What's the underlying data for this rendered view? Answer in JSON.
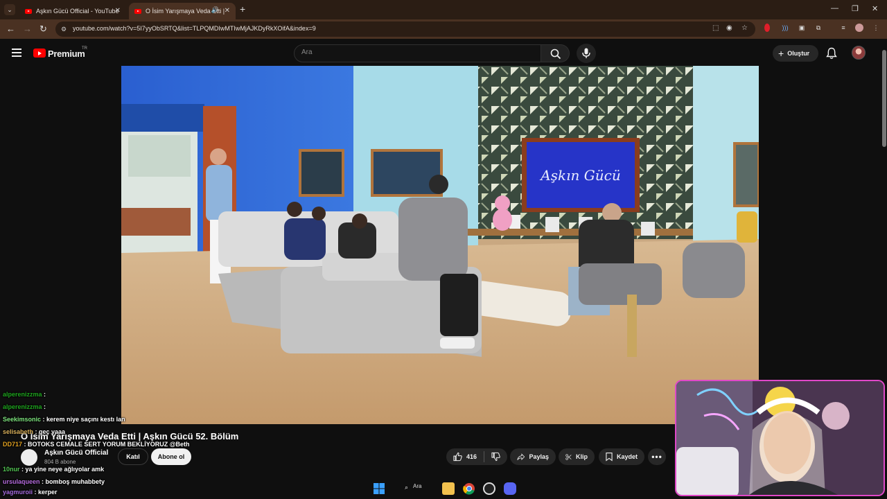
{
  "browser": {
    "tabs": [
      {
        "title": "Aşkın Gücü Official - YouTube"
      },
      {
        "title": "O İsim Yarışmaya Veda Etti |"
      }
    ],
    "url": "youtube.com/watch?v=5I7yyObSRTQ&list=TLPQMDIwMTIwMjAJKDyRkXOifA&index=9"
  },
  "youtube": {
    "logo_text": "Premium",
    "country": "TR",
    "search_placeholder": "Ara",
    "create_label": "Oluştur"
  },
  "video": {
    "title": "O İsim Yarışmaya Veda Etti | Aşkın Gücü 52. Bölüm",
    "tv_screen_text": "Aşkın Gücü",
    "channel": {
      "name": "Aşkın Gücü Official",
      "subscribers": "804 B abone"
    },
    "join_label": "Katıl",
    "subscribe_label": "Abone ol",
    "likes": "416",
    "share_label": "Paylaş",
    "clip_label": "Klip",
    "save_label": "Kaydet"
  },
  "chat": [
    {
      "user": "alperenizzma",
      "msg": ""
    },
    {
      "user": "alperenizzma",
      "msg": ""
    },
    {
      "user": "Seekimsonic",
      "msg": "kerem niye saçını kestı lan"
    },
    {
      "user": "selisabeth",
      "msg": "geç yaaa"
    },
    {
      "user": "DD717",
      "msg": "BOTOKS CEMALE SERT YORUM BEKLİYORUZ @Beth"
    },
    {
      "user": "10nur",
      "msg": "ya yine neye ağlıyolar amk"
    },
    {
      "user": "ursulaqueen",
      "msg": "bomboş muhabbety"
    },
    {
      "user": "yagmuroii",
      "msg": "kerper"
    }
  ],
  "chat_user_colors": [
    "#1ea51e",
    "#1ea51e",
    "#7ee57e",
    "#d9b05b",
    "#e0a020",
    "#52c452",
    "#b46bdc",
    "#a46bdc"
  ],
  "taskbar": {
    "search_label": "Ara"
  },
  "colors": {
    "accent": "#ff0000",
    "chrome_frame": "#4a3122",
    "webcam_border": "#e048c8"
  }
}
